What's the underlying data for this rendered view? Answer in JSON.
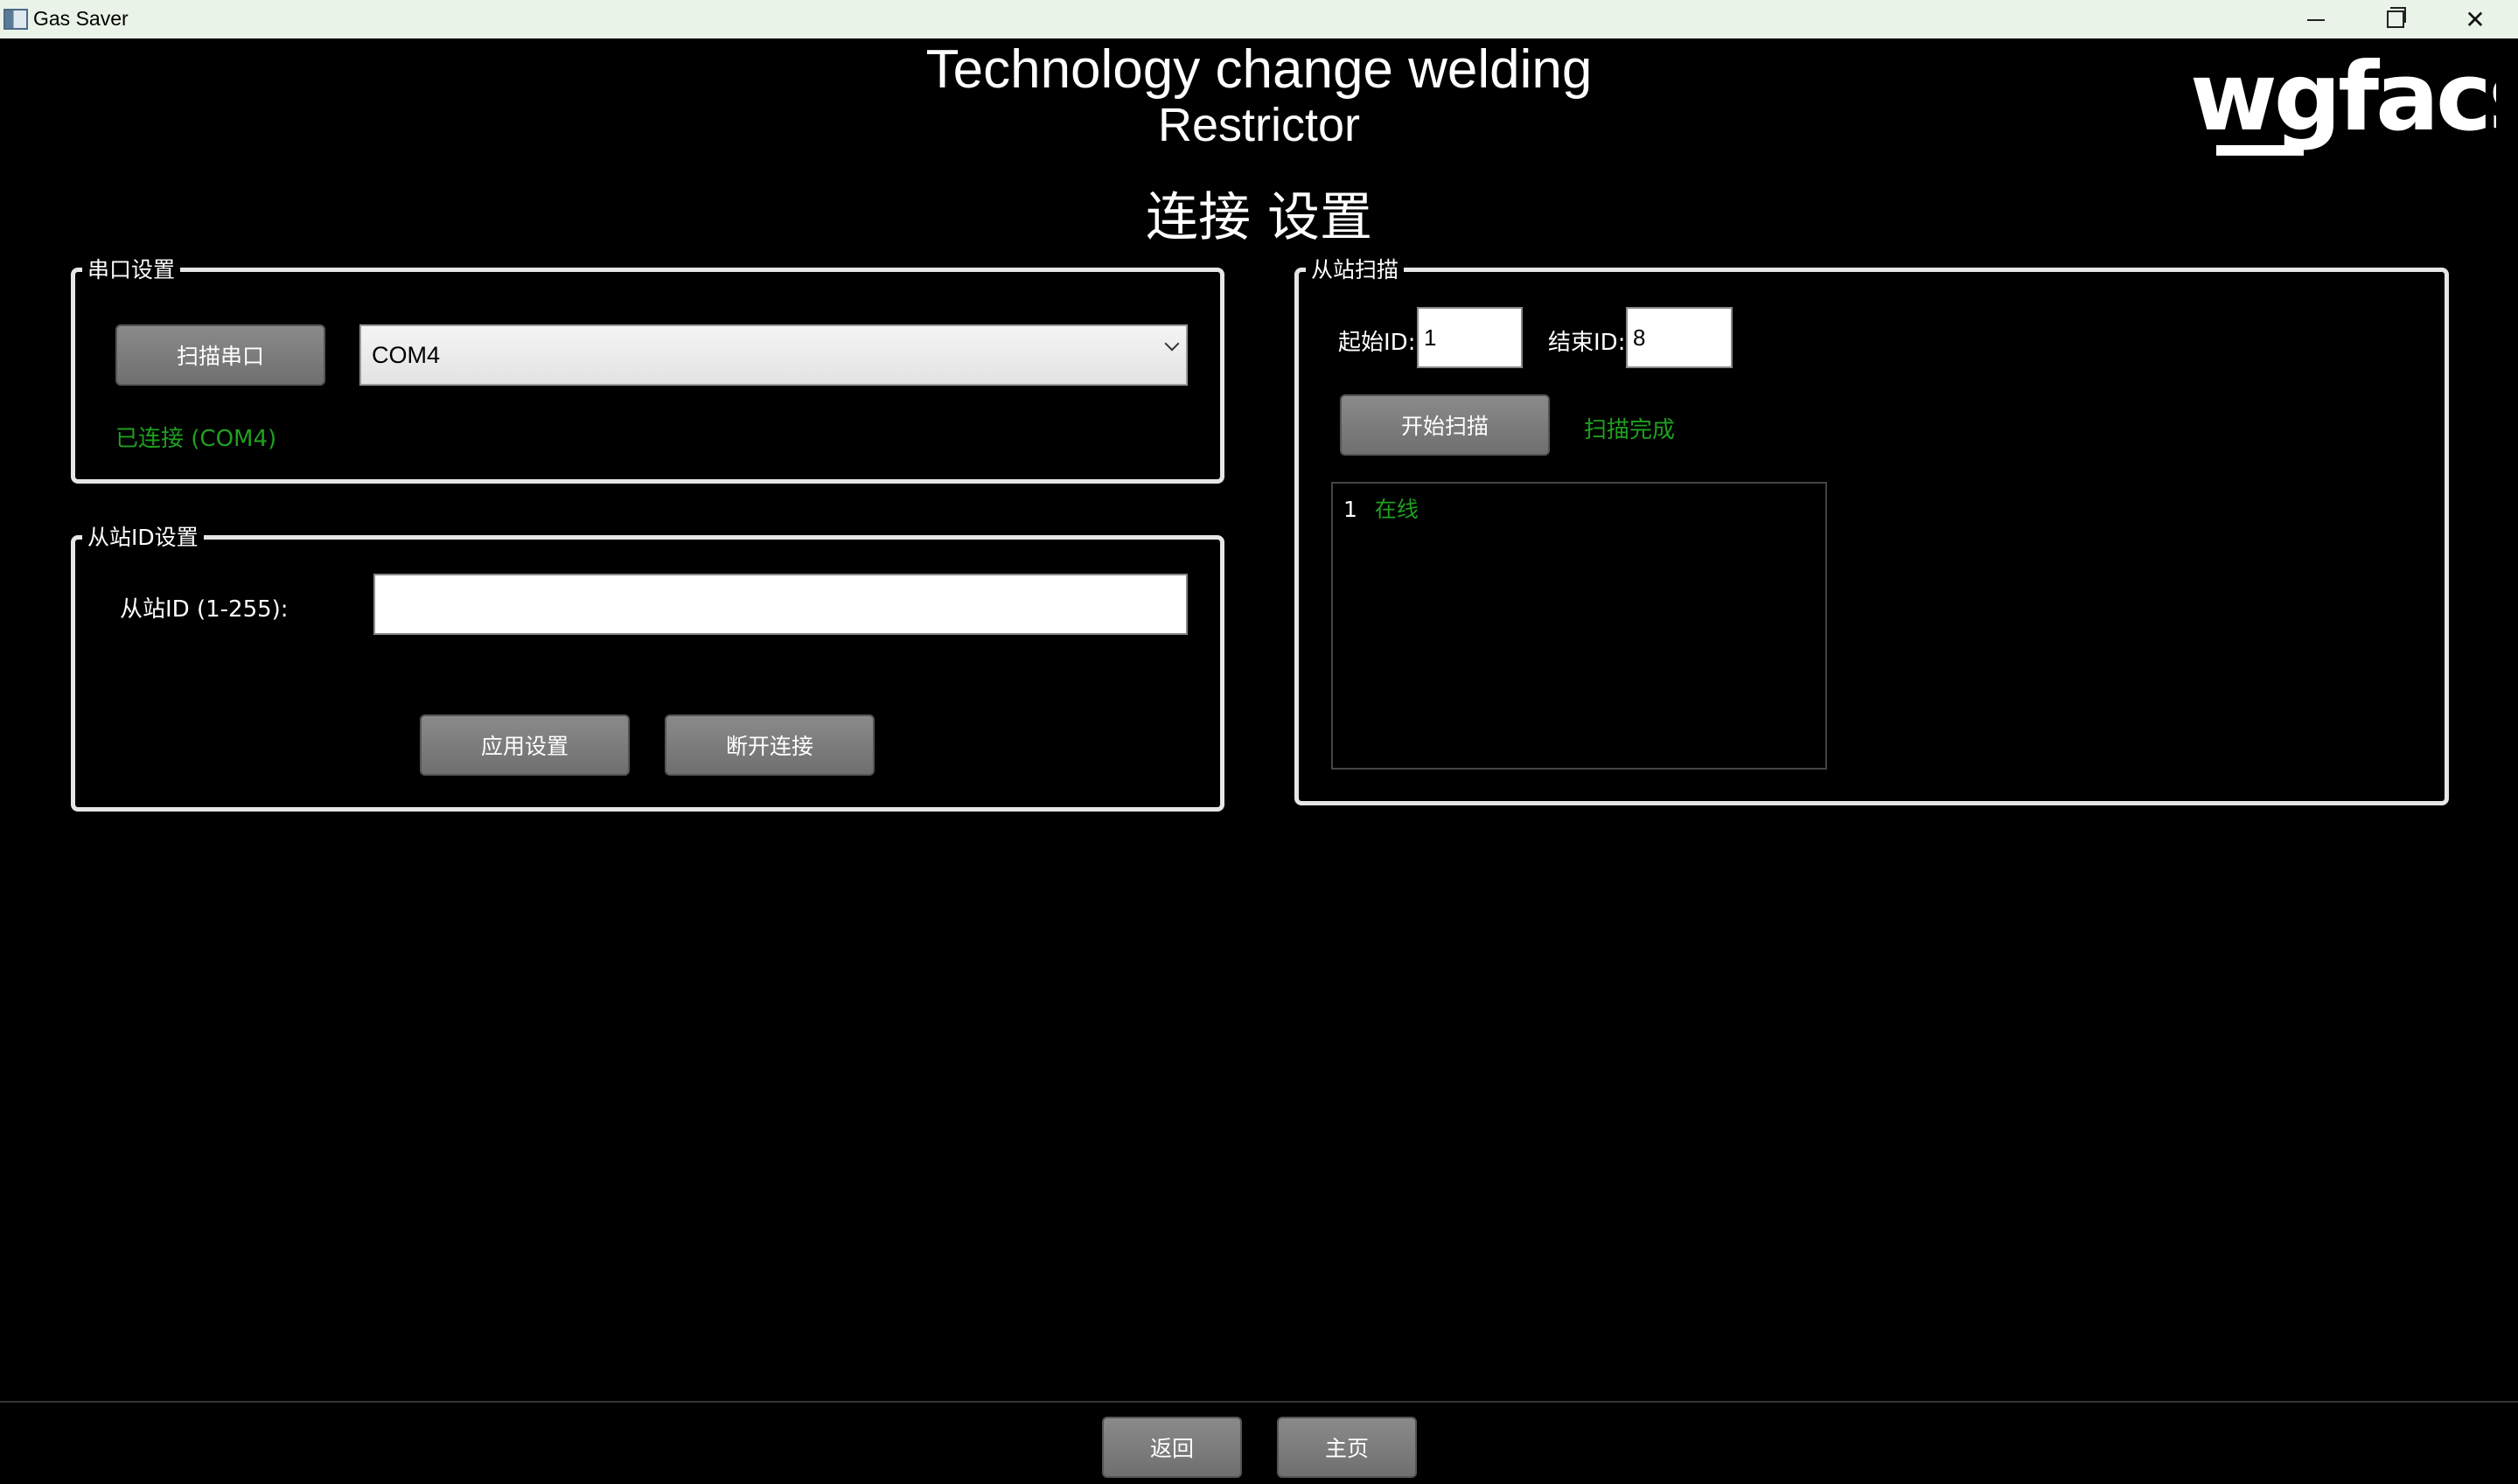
{
  "window": {
    "title": "Gas Saver",
    "minimize_icon": "minimize-icon",
    "maximize_icon": "restore-icon",
    "close_label": "✕"
  },
  "header": {
    "title_line1": "Technology change welding",
    "title_line2": "Restrictor",
    "page_heading": "连接 设置",
    "logo_text": "wgfacs"
  },
  "serial": {
    "group_label": "串口设置",
    "scan_button": "扫描串口",
    "port_selected": "COM4",
    "status": "已连接 (COM4)"
  },
  "slave_id": {
    "group_label": "从站ID设置",
    "field_label": "从站ID (1-255):",
    "field_value": "",
    "apply_button": "应用设置",
    "disconnect_button": "断开连接"
  },
  "scan": {
    "group_label": "从站扫描",
    "start_id_label": "起始ID:",
    "start_id_value": "1",
    "end_id_label": "结束ID:",
    "end_id_value": "8",
    "start_button": "开始扫描",
    "status": "扫描完成",
    "results": [
      {
        "id": "1",
        "state": "在线"
      }
    ]
  },
  "footer": {
    "back_button": "返回",
    "home_button": "主页"
  },
  "colors": {
    "background": "#000000",
    "status_green": "#1fa01f",
    "button_gray": "#7a7a7a"
  }
}
